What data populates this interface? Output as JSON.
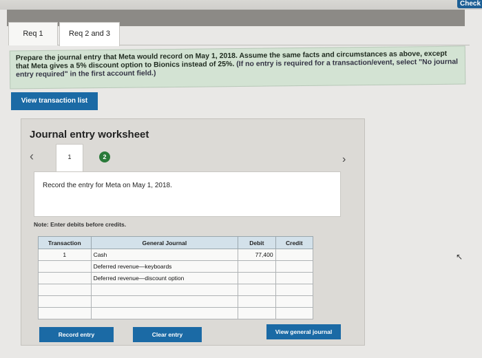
{
  "header": {
    "check_label": "Check"
  },
  "tabs": [
    {
      "label": "Req 1"
    },
    {
      "label": "Req 2 and 3"
    }
  ],
  "instructions": {
    "main": "Prepare the journal entry that Meta would record on May 1, 2018. Assume the same facts and circumstances as above, except that Meta gives a 5% discount option to Bionics instead of 25%.",
    "hint": "(If no entry is required for a transaction/event, select \"No journal entry required\" in the first account field.)"
  },
  "buttons": {
    "view_transaction_list": "View transaction list",
    "record_entry": "Record entry",
    "clear_entry": "Clear entry",
    "view_general_journal": "View general journal"
  },
  "worksheet": {
    "title": "Journal entry worksheet",
    "prev_icon": "chevron-left-icon",
    "next_icon": "chevron-right-icon",
    "steps": [
      "1",
      "2"
    ],
    "record_text": "Record the entry for Meta on May 1, 2018.",
    "note": "Note: Enter debits before credits."
  },
  "table": {
    "headers": [
      "Transaction",
      "General Journal",
      "Debit",
      "Credit"
    ],
    "rows": [
      {
        "tx": "1",
        "account": "Cash",
        "debit": "77,400",
        "credit": ""
      },
      {
        "tx": "",
        "account": "Deferred revenue—keyboards",
        "debit": "",
        "credit": ""
      },
      {
        "tx": "",
        "account": "Deferred revenue—discount option",
        "debit": "",
        "credit": ""
      },
      {
        "tx": "",
        "account": "",
        "debit": "",
        "credit": ""
      },
      {
        "tx": "",
        "account": "",
        "debit": "",
        "credit": ""
      },
      {
        "tx": "",
        "account": "",
        "debit": "",
        "credit": ""
      }
    ]
  },
  "colors": {
    "accent": "#1b6aa5",
    "step_active": "#2a7a3a",
    "instructions_bg": "#d3e3d3",
    "table_header_bg": "#d3e1ea"
  }
}
